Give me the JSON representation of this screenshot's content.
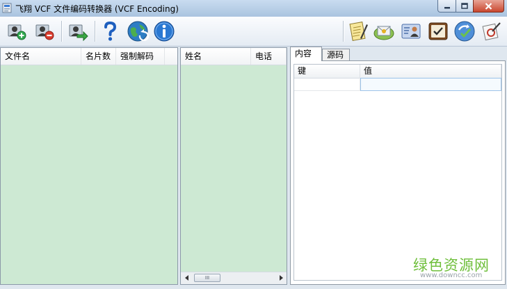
{
  "window": {
    "title": "飞翔 VCF 文件编码转换器 (VCF Encoding)"
  },
  "toolbar": {
    "left_icons": [
      "add-contact-icon",
      "remove-contact-icon",
      "convert-contact-icon",
      "help-icon",
      "web-update-icon",
      "info-icon"
    ],
    "right_icons": [
      "notepad-icon",
      "email-icon",
      "contact-card-icon",
      "clock-icon",
      "sync-icon",
      "tools-icon"
    ]
  },
  "files_panel": {
    "columns": [
      "文件名",
      "名片数",
      "强制解码"
    ]
  },
  "contacts_panel": {
    "columns": [
      "姓名",
      "电话"
    ]
  },
  "scrollbar": {
    "thumb_grip": "III"
  },
  "detail_panel": {
    "tabs": [
      "内容",
      "源码"
    ],
    "active_tab": 0,
    "columns": [
      "键",
      "值"
    ],
    "rows": [
      {
        "key": "",
        "value": ""
      }
    ]
  },
  "watermark": {
    "text": "绿色资源网",
    "url": "www.downcc.com"
  },
  "colors": {
    "list_bg": "#cde9d3",
    "accent": "#3a7bd5",
    "watermark": "#6fbf3c"
  }
}
